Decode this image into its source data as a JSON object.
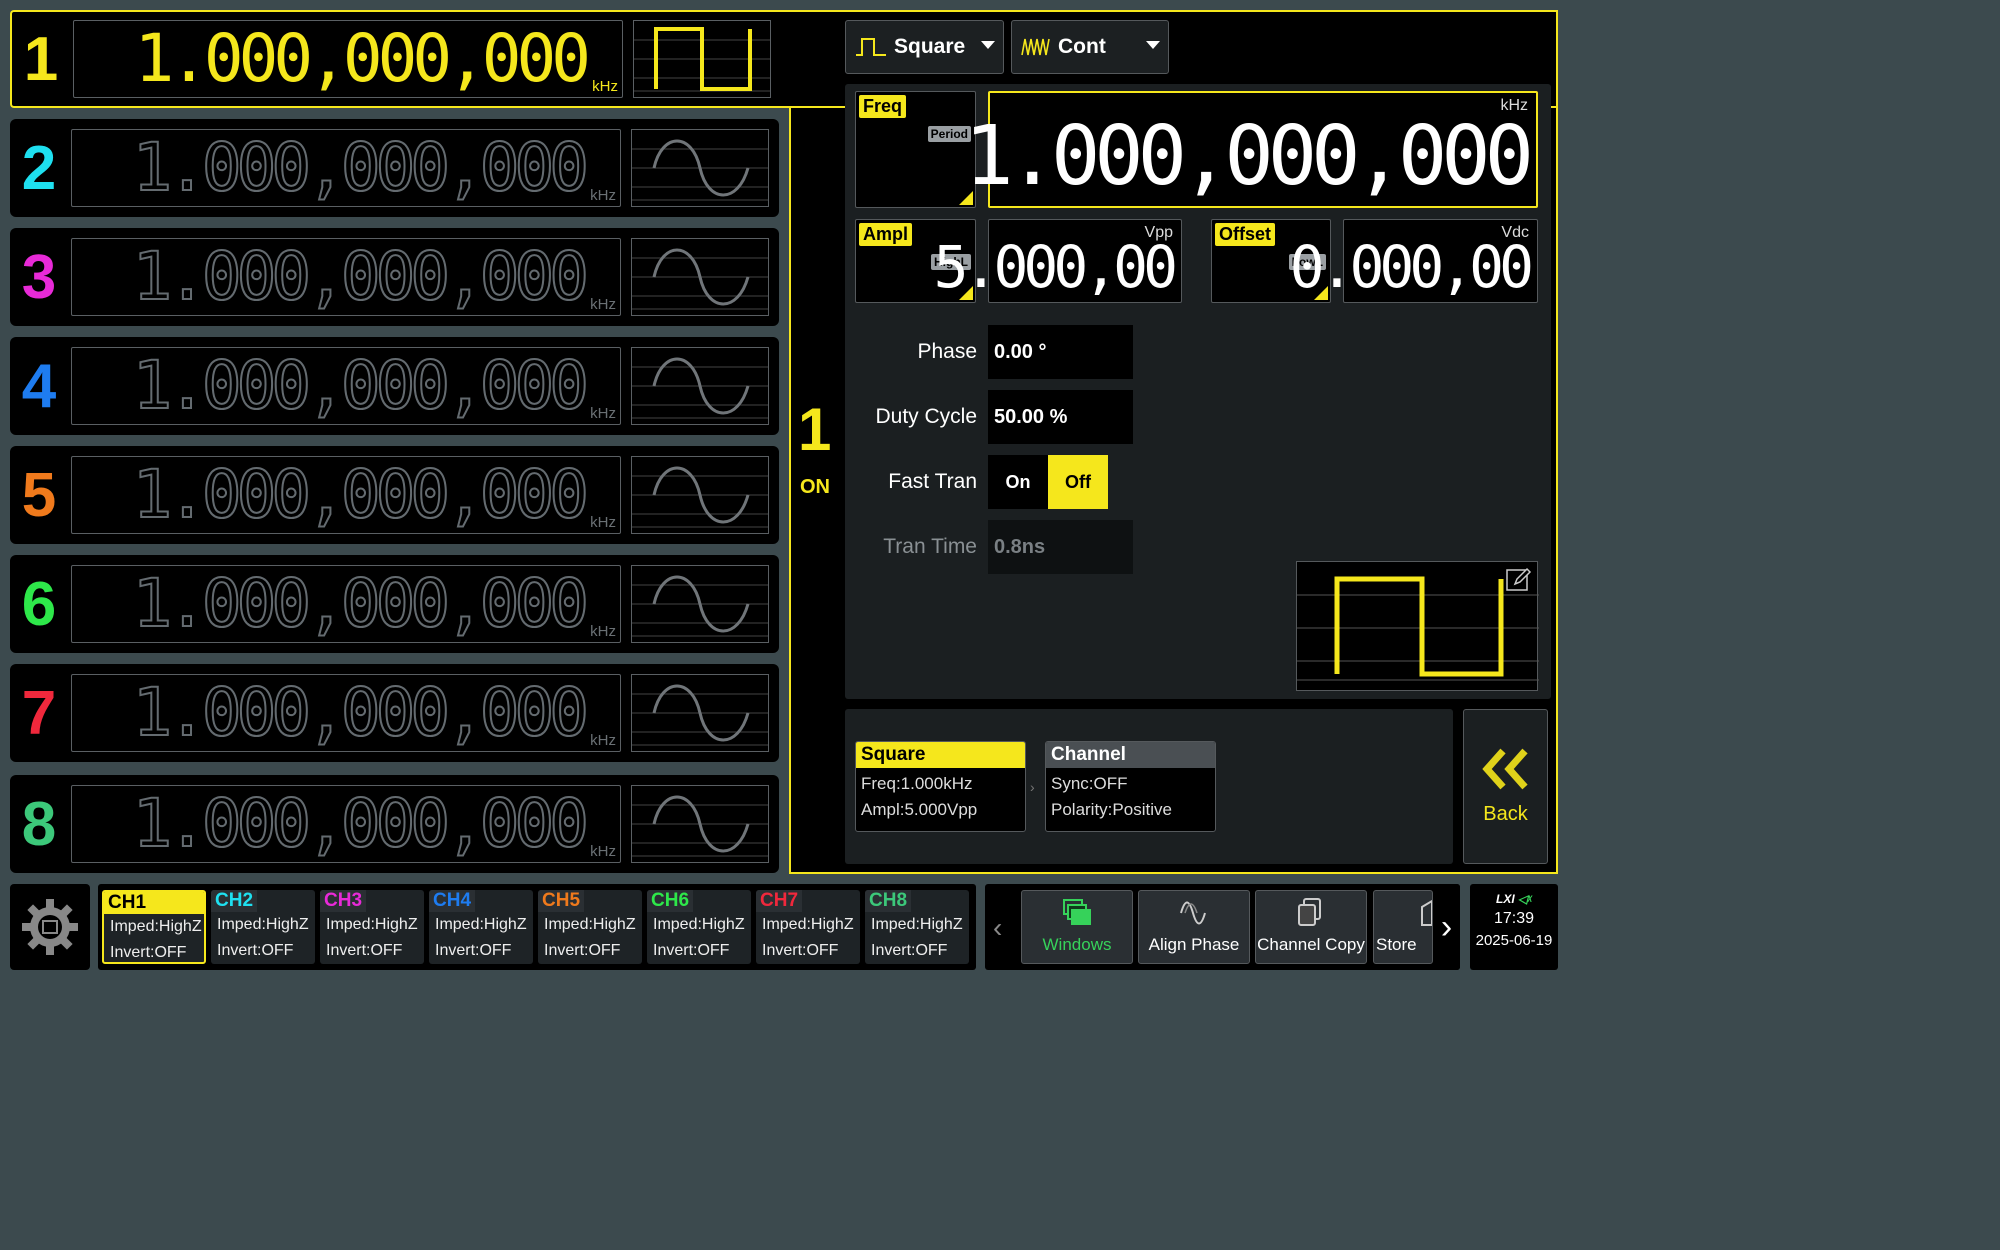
{
  "channels": [
    {
      "num": "1",
      "freq": "1.000,000,000",
      "unit": "kHz",
      "color": "#f5e71c",
      "wave": "square"
    },
    {
      "num": "2",
      "freq": "1.000,000,000",
      "unit": "kHz",
      "color": "#1ee0f0",
      "wave": "sine"
    },
    {
      "num": "3",
      "freq": "1.000,000,000",
      "unit": "kHz",
      "color": "#e82ad8",
      "wave": "sine"
    },
    {
      "num": "4",
      "freq": "1.000,000,000",
      "unit": "kHz",
      "color": "#1e7cf0",
      "wave": "sine"
    },
    {
      "num": "5",
      "freq": "1.000,000,000",
      "unit": "kHz",
      "color": "#f07a1c",
      "wave": "sine"
    },
    {
      "num": "6",
      "freq": "1.000,000,000",
      "unit": "kHz",
      "color": "#2ee84a",
      "wave": "sine"
    },
    {
      "num": "7",
      "freq": "1.000,000,000",
      "unit": "kHz",
      "color": "#f0283c",
      "wave": "sine"
    },
    {
      "num": "8",
      "freq": "1.000,000,000",
      "unit": "kHz",
      "color": "#3cc87a",
      "wave": "sine"
    }
  ],
  "selected": {
    "num": "1",
    "state": "ON"
  },
  "waveform_select": {
    "label": "Square",
    "icon": "square-wave-icon"
  },
  "mode_select": {
    "label": "Cont",
    "icon": "continuous-wave-icon"
  },
  "freq": {
    "tag": "Freq",
    "alt": "Period",
    "unit": "kHz",
    "value": "1.000,000,000"
  },
  "ampl": {
    "tag": "Ampl",
    "alt": "HighL",
    "unit": "Vpp",
    "value": "5.000,00"
  },
  "offset": {
    "tag": "Offset",
    "alt": "LowL",
    "unit": "Vdc",
    "value": "0.000,00"
  },
  "phase": {
    "label": "Phase",
    "value": "0.00 °"
  },
  "duty": {
    "label": "Duty Cycle",
    "value": "50.00 %"
  },
  "fast_tran": {
    "label": "Fast Tran",
    "on": "On",
    "off": "Off",
    "selected": "Off"
  },
  "tran_time": {
    "label": "Tran Time",
    "value": "0.8ns"
  },
  "cards": {
    "square": {
      "title": "Square",
      "line1": "Freq:1.000kHz",
      "line2": "Ampl:5.000Vpp"
    },
    "channel": {
      "title": "Channel",
      "line1": "Sync:OFF",
      "line2": "Polarity:Positive"
    }
  },
  "back": {
    "label": "Back"
  },
  "status_channels": [
    {
      "name": "CH1",
      "imped": "Imped:HighZ",
      "invert": "Invert:OFF",
      "color": "#f5e71c"
    },
    {
      "name": "CH2",
      "imped": "Imped:HighZ",
      "invert": "Invert:OFF",
      "color": "#1ee0f0"
    },
    {
      "name": "CH3",
      "imped": "Imped:HighZ",
      "invert": "Invert:OFF",
      "color": "#e82ad8"
    },
    {
      "name": "CH4",
      "imped": "Imped:HighZ",
      "invert": "Invert:OFF",
      "color": "#1e7cf0"
    },
    {
      "name": "CH5",
      "imped": "Imped:HighZ",
      "invert": "Invert:OFF",
      "color": "#f07a1c"
    },
    {
      "name": "CH6",
      "imped": "Imped:HighZ",
      "invert": "Invert:OFF",
      "color": "#2ee84a"
    },
    {
      "name": "CH7",
      "imped": "Imped:HighZ",
      "invert": "Invert:OFF",
      "color": "#f0283c"
    },
    {
      "name": "CH8",
      "imped": "Imped:HighZ",
      "invert": "Invert:OFF",
      "color": "#3cc87a"
    }
  ],
  "functions": [
    {
      "label": "Windows",
      "icon": "windows-icon"
    },
    {
      "label": "Align Phase",
      "icon": "align-phase-icon"
    },
    {
      "label": "Channel Copy",
      "icon": "channel-copy-icon"
    },
    {
      "label": "Store",
      "icon": "store-icon"
    }
  ],
  "clock": {
    "lxi": "LXI",
    "time": "17:39",
    "date": "2025-06-19"
  },
  "colors": {
    "accent": "#f5e71c",
    "windows_green": "#36d25a"
  }
}
